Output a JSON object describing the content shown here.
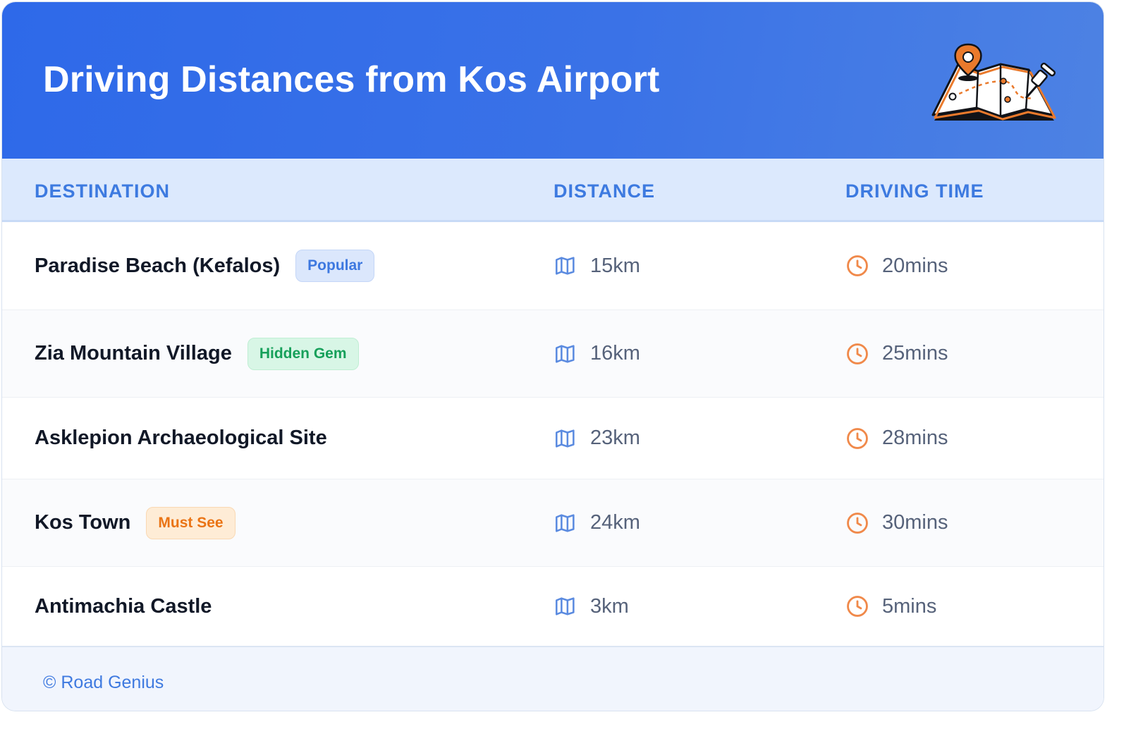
{
  "title": "Driving Distances from Kos Airport",
  "header_icon": "map-with-pins-icon",
  "columns": {
    "destination": "DESTINATION",
    "distance": "DISTANCE",
    "driving_time": "DRIVING TIME"
  },
  "rows": [
    {
      "destination": "Paradise Beach (Kefalos)",
      "badge": "Popular",
      "badge_style": "blue",
      "distance": "15km",
      "time": "20mins"
    },
    {
      "destination": "Zia Mountain Village",
      "badge": "Hidden Gem",
      "badge_style": "green",
      "distance": "16km",
      "time": "25mins"
    },
    {
      "destination": "Asklepion Archaeological Site",
      "badge": null,
      "badge_style": null,
      "distance": "23km",
      "time": "28mins"
    },
    {
      "destination": "Kos Town",
      "badge": "Must See",
      "badge_style": "orange",
      "distance": "24km",
      "time": "30mins"
    },
    {
      "destination": "Antimachia Castle",
      "badge": null,
      "badge_style": null,
      "distance": "3km",
      "time": "5mins"
    }
  ],
  "icons": {
    "distance": "map-icon",
    "time": "clock-icon"
  },
  "footer": "© Road Genius",
  "colors": {
    "header_gradient_start": "#2e69e9",
    "header_gradient_end": "#4d82e3",
    "column_header_text": "#3d7ae0",
    "map_icon": "#5b8be0",
    "clock_icon": "#f0894a"
  }
}
